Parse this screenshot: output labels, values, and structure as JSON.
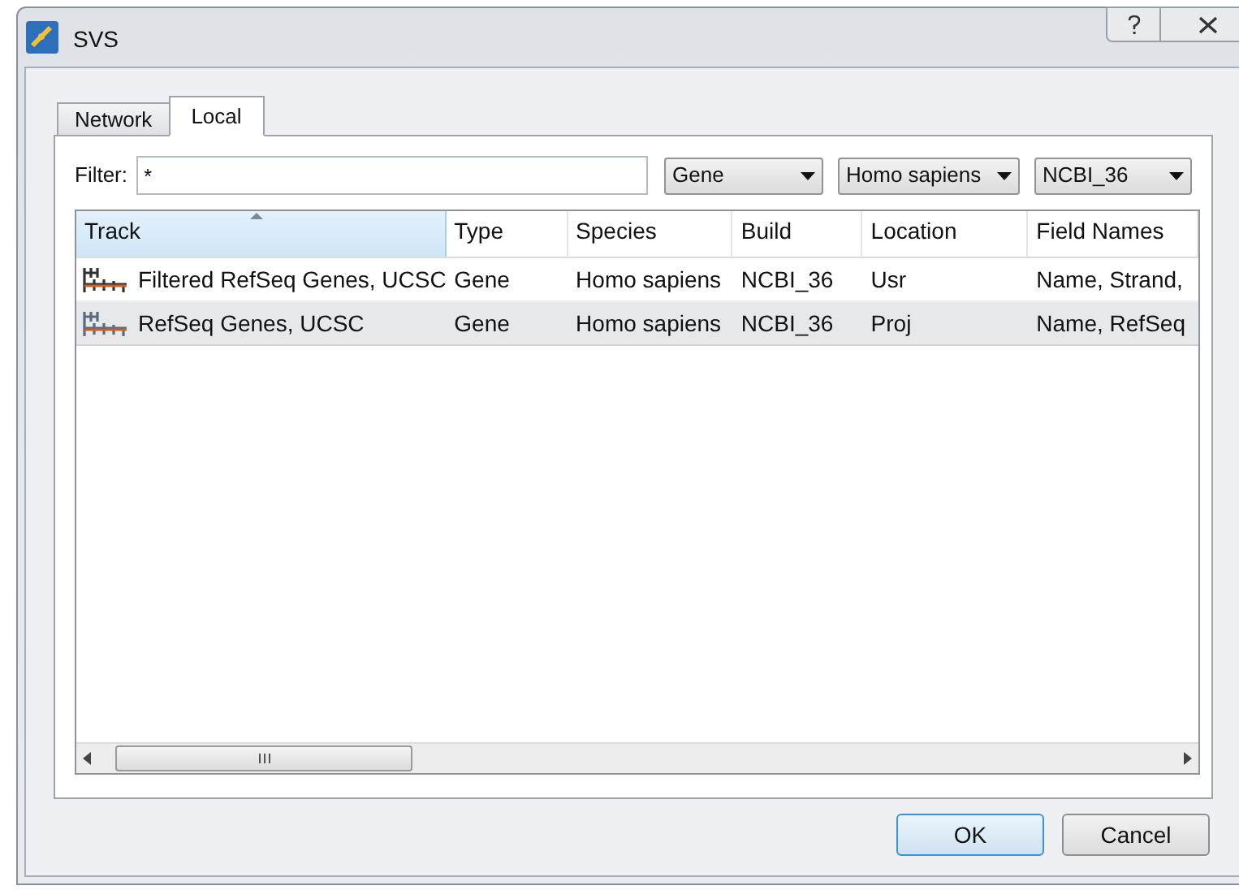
{
  "window": {
    "title": "SVS"
  },
  "tabs": [
    {
      "label": "Network",
      "selected": false
    },
    {
      "label": "Local",
      "selected": true
    }
  ],
  "filter": {
    "label": "Filter:",
    "value": "*"
  },
  "dropdowns": [
    "Gene",
    "Homo sapiens",
    "NCBI_36"
  ],
  "table": {
    "columns": [
      {
        "label": "Track",
        "sorted": true
      },
      {
        "label": "Type",
        "sorted": false
      },
      {
        "label": "Species",
        "sorted": false
      },
      {
        "label": "Build",
        "sorted": false
      },
      {
        "label": "Location",
        "sorted": false
      },
      {
        "label": "Field Names",
        "sorted": false
      }
    ],
    "rows": [
      {
        "selected": false,
        "cells": [
          "Filtered RefSeq Genes, UCSC",
          "Gene",
          "Homo sapiens",
          "NCBI_36",
          "Usr",
          "Name, Strand,"
        ]
      },
      {
        "selected": true,
        "cells": [
          "RefSeq Genes, UCSC",
          "Gene",
          "Homo sapiens",
          "NCBI_36",
          "Proj",
          "Name, RefSeq"
        ]
      }
    ]
  },
  "buttons": [
    {
      "label": "OK",
      "kind": "default"
    },
    {
      "label": "Cancel",
      "kind": "normal"
    }
  ]
}
